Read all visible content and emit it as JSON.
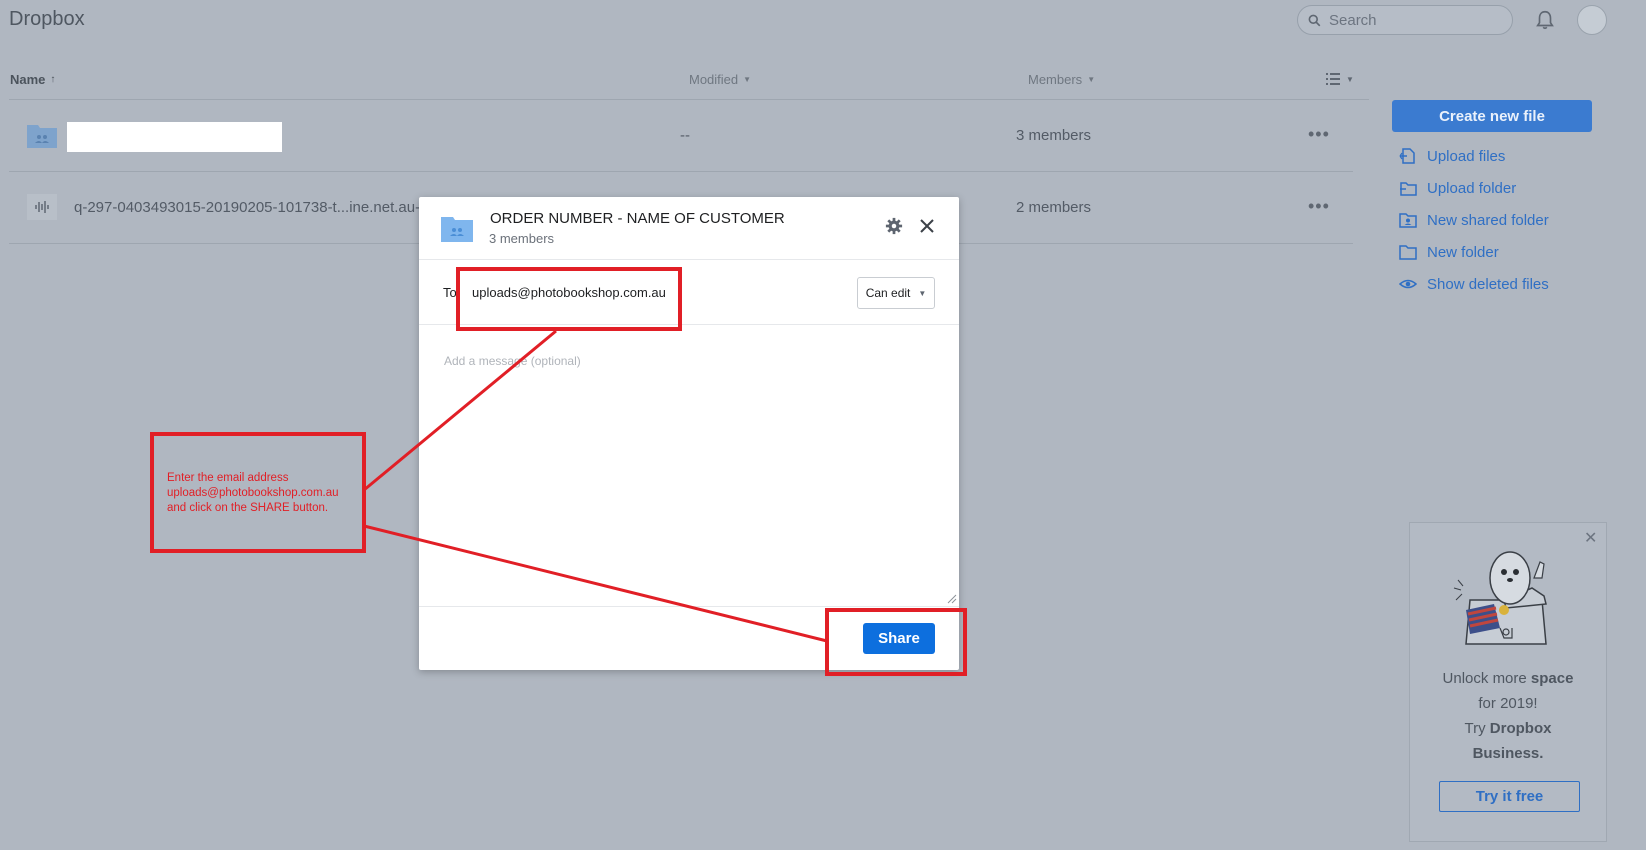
{
  "header": {
    "app_title": "Dropbox",
    "search_placeholder": "Search"
  },
  "list": {
    "columns": {
      "name": "Name",
      "modified": "Modified",
      "members": "Members"
    },
    "rows": [
      {
        "name": "",
        "modified": "--",
        "members": "3 members"
      },
      {
        "name": "q-297-0403493015-20190205-101738-t...ine.net.au-",
        "modified": "",
        "members": "2 members"
      }
    ]
  },
  "sidebar": {
    "create_label": "Create new file",
    "links": [
      {
        "label": "Upload files",
        "icon": "upload-files-icon"
      },
      {
        "label": "Upload folder",
        "icon": "upload-folder-icon"
      },
      {
        "label": "New shared folder",
        "icon": "shared-folder-icon"
      },
      {
        "label": "New folder",
        "icon": "folder-icon"
      },
      {
        "label": "Show deleted files",
        "icon": "eye-icon"
      }
    ]
  },
  "promo": {
    "line1_a": "Unlock more ",
    "line1_b": "space",
    "line2": "for 2019!",
    "line3_a": "Try ",
    "line3_b": "Dropbox",
    "line4": "Business.",
    "button": "Try it free"
  },
  "modal": {
    "title": "ORDER NUMBER -  NAME OF CUSTOMER",
    "subtitle": "3 members",
    "to_label": "To",
    "to_value": "uploads@photobookshop.com.au",
    "permission": "Can edit",
    "message_placeholder": "Add a message (optional)",
    "share_label": "Share"
  },
  "annotation": {
    "line1": "Enter the email address",
    "line2": "uploads@photobookshop.com.au",
    "line3": "and click on the SHARE button."
  },
  "colors": {
    "background_dim": "#b0b7c1",
    "accent": "#0d6fde",
    "annotation_red": "#e11f26"
  }
}
